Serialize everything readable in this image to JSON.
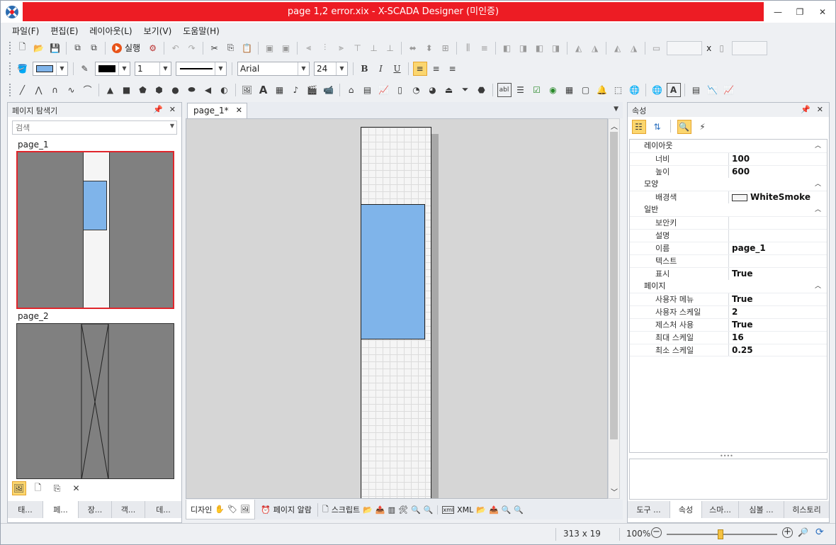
{
  "title": "page 1,2 error.xix - X-SCADA Designer (미인증)",
  "menu": [
    "파일(F)",
    "편집(E)",
    "레이아웃(L)",
    "보기(V)",
    "도움말(H)"
  ],
  "toolbar": {
    "run_label": "실행",
    "font_name": "Arial",
    "font_size": "24",
    "line_width": "1",
    "width_value": "",
    "height_value": "",
    "x_sep": "x",
    "bold": "B",
    "italic": "I",
    "underline": "U",
    "fill_color": "#7fb4ea",
    "stroke_color": "#000000"
  },
  "left_panel": {
    "title": "페이지 탐색기",
    "search_placeholder": "검색",
    "pages": [
      "page_1",
      "page_2"
    ],
    "bottom_tabs": [
      "태...",
      "페...",
      "장...",
      "객...",
      "데..."
    ]
  },
  "document": {
    "tab_label": "page_1*",
    "bottom_tabs": [
      "디자인",
      "페이지 알람",
      "스크립트",
      "XML"
    ]
  },
  "right_panel": {
    "title": "속성",
    "groups": [
      {
        "name": "레이아웃",
        "rows": [
          [
            "너비",
            "100"
          ],
          [
            "높이",
            "600"
          ]
        ]
      },
      {
        "name": "모양",
        "rows": [
          [
            "배경색",
            "WhiteSmoke"
          ]
        ]
      },
      {
        "name": "일반",
        "rows": [
          [
            "보안키",
            ""
          ],
          [
            "설명",
            ""
          ],
          [
            "이름",
            "page_1"
          ],
          [
            "텍스트",
            ""
          ],
          [
            "표시",
            "True"
          ]
        ]
      },
      {
        "name": "페이지",
        "rows": [
          [
            "사용자 메뉴",
            "True"
          ],
          [
            "사용자 스케일",
            "2"
          ],
          [
            "제스처 사용",
            "True"
          ],
          [
            "최대 스케일",
            "16"
          ],
          [
            "최소 스케일",
            "0.25"
          ]
        ]
      }
    ],
    "bottom_tabs": [
      "도구 ...",
      "속성",
      "스마...",
      "심볼 ...",
      "히스토리"
    ]
  },
  "status": {
    "size": "313 x 19",
    "zoom": "100%"
  },
  "colors": {
    "title_red": "#ed1c24",
    "shape_blue": "#7fb4ea",
    "selection_red": "#e0262c"
  }
}
